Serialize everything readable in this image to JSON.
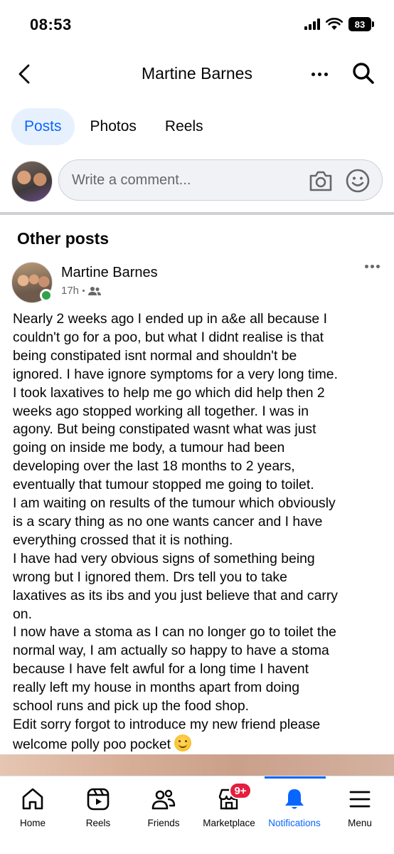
{
  "status_bar": {
    "time": "08:53",
    "battery": "83"
  },
  "header": {
    "title": "Martine Barnes",
    "back_icon": "chevron-left-icon",
    "more_icon": "more-horizontal-icon",
    "search_icon": "search-icon"
  },
  "tabs": [
    {
      "label": "Posts",
      "active": true
    },
    {
      "label": "Photos",
      "active": false
    },
    {
      "label": "Reels",
      "active": false
    }
  ],
  "comment": {
    "placeholder": "Write a comment...",
    "camera_icon": "camera-icon",
    "emoji_icon": "smile-icon"
  },
  "section": {
    "title": "Other posts"
  },
  "post": {
    "author": "Martine Barnes",
    "time": "17h",
    "audience_icon": "friends-icon",
    "lines": [
      "Nearly 2 weeks ago I ended up in a&e all because I",
      "couldn't go for a poo, but what I didnt realise is that",
      "being constipated isnt normal and shouldn't be",
      "ignored. I have ignore symptoms for a very long time.",
      "I took laxatives to help me go which did help then 2",
      "weeks ago stopped working all together. I was in",
      "agony. But being constipated wasnt what was just",
      "going on inside me body, a tumour had been",
      "developing over the last 18 months to 2 years,",
      "eventually that tumour stopped me going to toilet.",
      "I am waiting on results of the tumour which obviously",
      "is a scary thing as no one wants cancer and I have",
      "everything crossed that it is nothing.",
      "I have had very obvious signs of something being",
      "wrong but I ignored them. Drs tell you to take",
      "laxatives as its ibs and you just believe that and carry",
      "on.",
      "I now have a stoma as I can no longer go to toilet the",
      "normal way, I am actually so happy to have a stoma",
      "because I have felt awful for a long time I havent",
      "really left my house in months apart from doing",
      "school runs and pick up the food shop.",
      "Edit sorry forgot to introduce my new friend please",
      "welcome polly poo pocket"
    ],
    "trailing_emoji": "smiling-face-emoji"
  },
  "bottom_nav": [
    {
      "label": "Home",
      "icon": "home-icon",
      "active": false
    },
    {
      "label": "Reels",
      "icon": "reels-icon",
      "active": false
    },
    {
      "label": "Friends",
      "icon": "friends-icon",
      "active": false
    },
    {
      "label": "Marketplace",
      "icon": "marketplace-icon",
      "active": false,
      "badge": "9+"
    },
    {
      "label": "Notifications",
      "icon": "bell-icon",
      "active": true
    },
    {
      "label": "Menu",
      "icon": "menu-icon",
      "active": false
    }
  ],
  "colors": {
    "accent": "#0866ff",
    "badge": "#e41e3f",
    "online": "#31a24c",
    "secondary_text": "#65676b"
  }
}
